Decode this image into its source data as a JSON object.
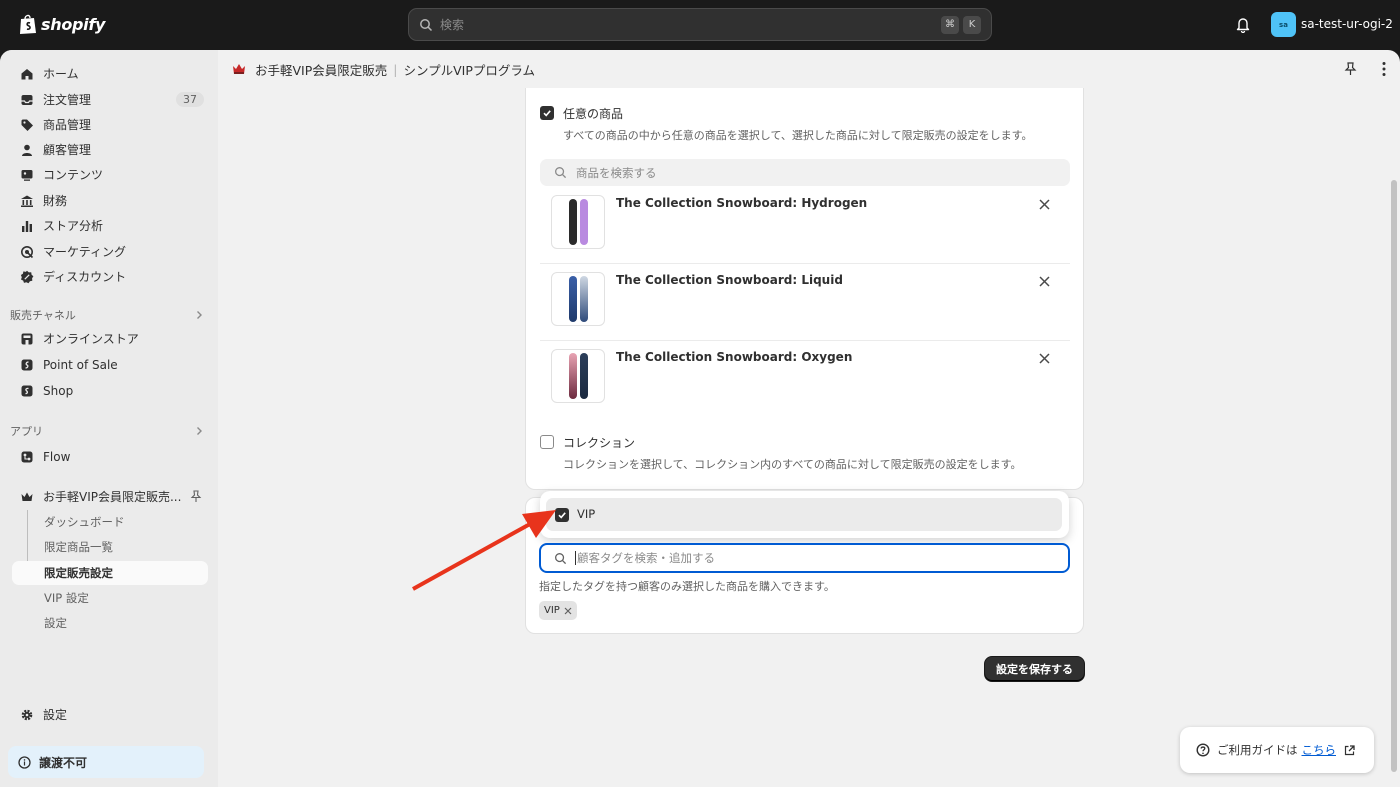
{
  "topbar": {
    "logo_text": "shopify",
    "search_placeholder": "検索",
    "shortcut_keys": [
      "⌘",
      "K"
    ],
    "store_initials": "sa",
    "store_name": "sa-test-ur-ogi-2"
  },
  "sidebar": {
    "items": [
      {
        "label": "ホーム",
        "icon": "home-icon"
      },
      {
        "label": "注文管理",
        "icon": "inbox-icon",
        "badge": "37"
      },
      {
        "label": "商品管理",
        "icon": "tag-icon"
      },
      {
        "label": "顧客管理",
        "icon": "person-icon"
      },
      {
        "label": "コンテンツ",
        "icon": "content-icon"
      },
      {
        "label": "財務",
        "icon": "bank-icon"
      },
      {
        "label": "ストア分析",
        "icon": "bar-chart-icon"
      },
      {
        "label": "マーケティング",
        "icon": "target-icon"
      },
      {
        "label": "ディスカウント",
        "icon": "discount-icon"
      }
    ],
    "sales_channels_label": "販売チャネル",
    "channels": [
      {
        "label": "オンラインストア",
        "icon": "store-icon"
      },
      {
        "label": "Point of Sale",
        "icon": "pos-icon"
      },
      {
        "label": "Shop",
        "icon": "shop-icon"
      }
    ],
    "apps_label": "アプリ",
    "apps": [
      {
        "label": "Flow",
        "icon": "flow-icon"
      }
    ],
    "pinned_app": "お手軽VIP会員限定販売...",
    "pinned_sub": [
      "ダッシュボード",
      "限定商品一覧",
      "限定販売設定",
      "VIP 設定",
      "設定"
    ],
    "settings_label": "設定",
    "warning_label": "譲渡不可"
  },
  "header": {
    "app_name": "お手軽VIP会員限定販売",
    "page_title": "シンプルVIPプログラム"
  },
  "product_card": {
    "any_product_label": "任意の商品",
    "any_product_help": "すべての商品の中から任意の商品を選択して、選択した商品に対して限定販売の設定をします。",
    "search_placeholder": "商品を検索する",
    "products": [
      {
        "title": "The Collection Snowboard: Hydrogen"
      },
      {
        "title": "The Collection Snowboard: Liquid"
      },
      {
        "title": "The Collection Snowboard: Oxygen"
      }
    ],
    "collection_label": "コレクション",
    "collection_help": "コレクションを選択して、コレクション内のすべての商品に対して限定販売の設定をします。"
  },
  "tag_card": {
    "dropdown_option": "VIP",
    "search_placeholder": "顧客タグを検索・追加する",
    "help": "指定したタグを持つ顧客のみ選択した商品を購入できます。",
    "selected_tag": "VIP"
  },
  "save_label": "設定を保存する",
  "guide": {
    "text": "ご利用ガイドは",
    "link": "こちら"
  },
  "colors": {
    "topbar": "#1a1a1a",
    "focus": "#005bd3",
    "arrow": "#e8341c"
  }
}
